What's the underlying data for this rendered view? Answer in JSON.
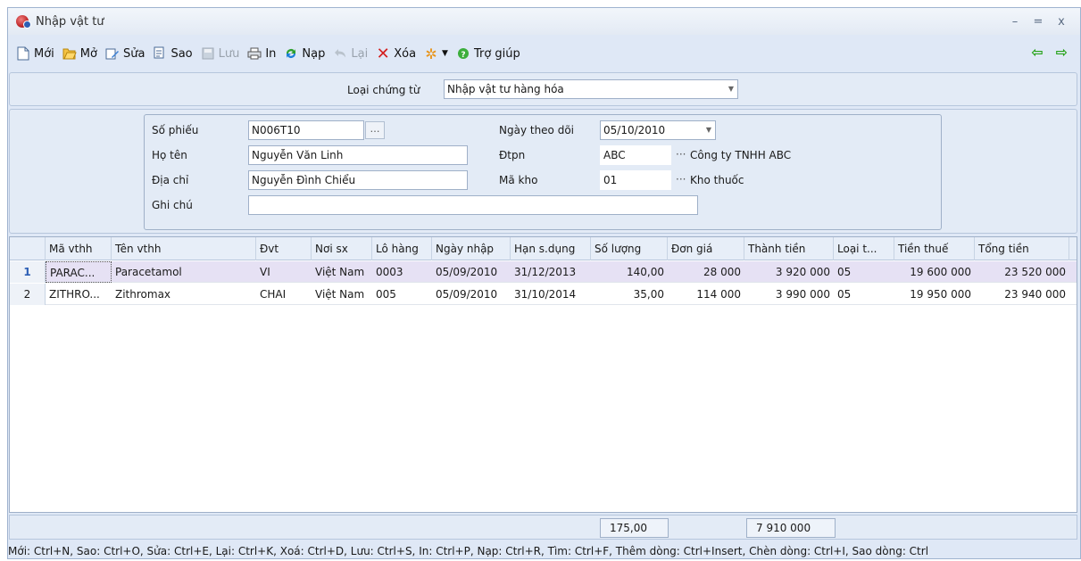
{
  "window": {
    "title": "Nhập vật tư",
    "minimize": "–",
    "maximize": "=",
    "close": "x"
  },
  "toolbar": {
    "new": "Mới",
    "open": "Mở",
    "edit": "Sửa",
    "copy": "Sao",
    "save": "Lưu",
    "print": "In",
    "reload": "Nạp",
    "undo": "Lại",
    "delete": "Xóa",
    "help": "Trợ giúp"
  },
  "voucher": {
    "label": "Loại chứng từ",
    "value": "Nhập vật tư hàng hóa"
  },
  "form": {
    "so_phieu_label": "Số phiếu",
    "so_phieu": "N006T10",
    "ho_ten_label": "Họ tên",
    "ho_ten": "Nguyễn Văn Linh",
    "dia_chi_label": "Địa chỉ",
    "dia_chi": "Nguyễn Đình Chiểu",
    "ghi_chu_label": "Ghi chú",
    "ghi_chu": "",
    "ngay_label": "Ngày theo dõi",
    "ngay": "05/10/2010",
    "dtpn_label": "Đtpn",
    "dtpn": "ABC",
    "dtpn_name": "Công ty TNHH ABC",
    "ma_kho_label": "Mã kho",
    "ma_kho": "01",
    "ma_kho_name": "Kho thuốc"
  },
  "grid": {
    "columns": [
      "Mã vthh",
      "Tên vthh",
      "Đvt",
      "Nơi sx",
      "Lô hàng",
      "Ngày nhập",
      "Hạn s.dụng",
      "Số lượng",
      "Đơn giá",
      "Thành tiền",
      "Loại t...",
      "Tiền thuế",
      "Tổng tiền"
    ],
    "rows": [
      {
        "n": "1",
        "ma": "PARAC...",
        "ten": "Paracetamol",
        "dvt": "VI",
        "noi": "Việt Nam",
        "lo": "0003",
        "ngay": "05/09/2010",
        "han": "31/12/2013",
        "sl": "140,00",
        "dg": "28 000",
        "tt": "3 920 000",
        "loai": "05",
        "thue": "19 600 000",
        "tong": "23 520 000"
      },
      {
        "n": "2",
        "ma": "ZITHRO...",
        "ten": "Zithromax",
        "dvt": "CHAI",
        "noi": "Việt Nam",
        "lo": "005",
        "ngay": "05/09/2010",
        "han": "31/10/2014",
        "sl": "35,00",
        "dg": "114 000",
        "tt": "3 990 000",
        "loai": "05",
        "thue": "19 950 000",
        "tong": "23 940 000"
      }
    ]
  },
  "summary": {
    "so_luong": "175,00",
    "thanh_tien": "7 910 000"
  },
  "status": "Mới: Ctrl+N, Sao: Ctrl+O, Sửa: Ctrl+E, Lại: Ctrl+K, Xoá: Ctrl+D, Lưu: Ctrl+S, In: Ctrl+P, Nạp: Ctrl+R, Tìm: Ctrl+F, Thêm dòng: Ctrl+Insert, Chèn dòng: Ctrl+I, Sao dòng: Ctrl",
  "icons": {
    "app": "app-logo-icon",
    "prev": "arrow-left-icon",
    "next": "arrow-right-icon"
  },
  "colors": {
    "accent": "#2d5fb5",
    "selected_row": "#e6e1f4",
    "nav_arrow": "#27a31a",
    "delete": "#d42020"
  }
}
